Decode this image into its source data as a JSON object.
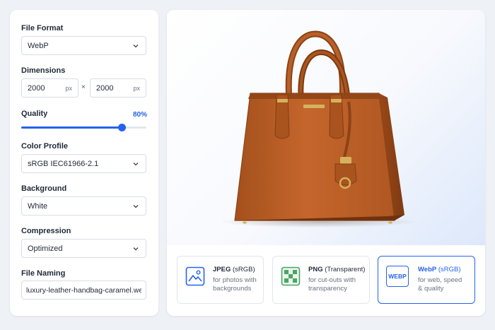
{
  "settings": {
    "file_format": {
      "label": "File Format",
      "value": "WebP"
    },
    "dimensions": {
      "label": "Dimensions",
      "width": "2000",
      "height": "2000",
      "unit": "px",
      "separator": "×"
    },
    "quality": {
      "label": "Quality",
      "value_text": "80%",
      "value": 0.8
    },
    "color_profile": {
      "label": "Color Profile",
      "value": "sRGB IEC61966-2.1"
    },
    "background": {
      "label": "Background",
      "value": "White"
    },
    "compression": {
      "label": "Compression",
      "value": "Optimized"
    },
    "file_naming": {
      "label": "File Naming",
      "value": "luxury-leather-handbag-caramel.webp"
    }
  },
  "formats": [
    {
      "name": "JPEG",
      "qualifier": "(sRGB)",
      "desc": "for photos with backgrounds",
      "icon": "image-icon",
      "selected": false
    },
    {
      "name": "PNG",
      "qualifier": "(Transparent)",
      "desc": "for cut-outs with transparency",
      "icon": "checker-icon",
      "selected": false
    },
    {
      "name": "WebP",
      "qualifier": "(sRGB)",
      "desc": "for web, speed & quality",
      "icon": "webp-badge-icon",
      "badge": "WEBP",
      "selected": true
    }
  ],
  "colors": {
    "accent": "#2563eb",
    "leather": "#b35a24",
    "panel_bg": "#eef1f6"
  }
}
